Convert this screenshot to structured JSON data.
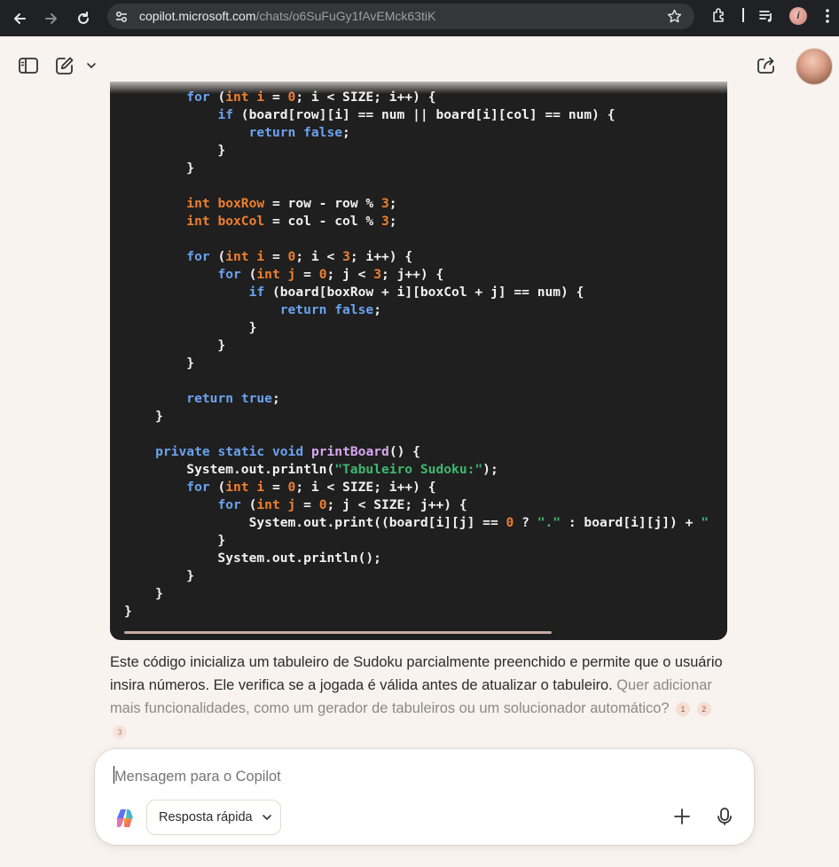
{
  "browser": {
    "url_domain": "copilot.microsoft.com",
    "url_path": "/chats/o6SuFuGy1fAvEMck63tiK",
    "profile_initial": "i"
  },
  "app": {
    "brand_accent": "#f5ded2"
  },
  "code": {
    "lines": [
      [
        {
          "t": "        "
        },
        {
          "t": "for",
          "c": "kw"
        },
        {
          "t": " ("
        },
        {
          "t": "int",
          "c": "ty"
        },
        {
          "t": " "
        },
        {
          "t": "i",
          "c": "ty"
        },
        {
          "t": " = "
        },
        {
          "t": "0",
          "c": "num"
        },
        {
          "t": "; i < SIZE; i++) {"
        }
      ],
      [
        {
          "t": "            "
        },
        {
          "t": "if",
          "c": "kw"
        },
        {
          "t": " (board[row][i] == num || board[i][col] == num) {"
        }
      ],
      [
        {
          "t": "                "
        },
        {
          "t": "return",
          "c": "kw"
        },
        {
          "t": " "
        },
        {
          "t": "false",
          "c": "kw"
        },
        {
          "t": ";"
        }
      ],
      [
        {
          "t": "            }"
        }
      ],
      [
        {
          "t": "        }"
        }
      ],
      [
        {
          "t": ""
        }
      ],
      [
        {
          "t": "        "
        },
        {
          "t": "int",
          "c": "ty"
        },
        {
          "t": " "
        },
        {
          "t": "boxRow",
          "c": "ty"
        },
        {
          "t": " = row - row % "
        },
        {
          "t": "3",
          "c": "num"
        },
        {
          "t": ";"
        }
      ],
      [
        {
          "t": "        "
        },
        {
          "t": "int",
          "c": "ty"
        },
        {
          "t": " "
        },
        {
          "t": "boxCol",
          "c": "ty"
        },
        {
          "t": " = col - col % "
        },
        {
          "t": "3",
          "c": "num"
        },
        {
          "t": ";"
        }
      ],
      [
        {
          "t": ""
        }
      ],
      [
        {
          "t": "        "
        },
        {
          "t": "for",
          "c": "kw"
        },
        {
          "t": " ("
        },
        {
          "t": "int",
          "c": "ty"
        },
        {
          "t": " "
        },
        {
          "t": "i",
          "c": "ty"
        },
        {
          "t": " = "
        },
        {
          "t": "0",
          "c": "num"
        },
        {
          "t": "; i < "
        },
        {
          "t": "3",
          "c": "num"
        },
        {
          "t": "; i++) {"
        }
      ],
      [
        {
          "t": "            "
        },
        {
          "t": "for",
          "c": "kw"
        },
        {
          "t": " ("
        },
        {
          "t": "int",
          "c": "ty"
        },
        {
          "t": " "
        },
        {
          "t": "j",
          "c": "ty"
        },
        {
          "t": " = "
        },
        {
          "t": "0",
          "c": "num"
        },
        {
          "t": "; j < "
        },
        {
          "t": "3",
          "c": "num"
        },
        {
          "t": "; j++) {"
        }
      ],
      [
        {
          "t": "                "
        },
        {
          "t": "if",
          "c": "kw"
        },
        {
          "t": " (board[boxRow + i][boxCol + j] == num) {"
        }
      ],
      [
        {
          "t": "                    "
        },
        {
          "t": "return",
          "c": "kw"
        },
        {
          "t": " "
        },
        {
          "t": "false",
          "c": "kw"
        },
        {
          "t": ";"
        }
      ],
      [
        {
          "t": "                }"
        }
      ],
      [
        {
          "t": "            }"
        }
      ],
      [
        {
          "t": "        }"
        }
      ],
      [
        {
          "t": ""
        }
      ],
      [
        {
          "t": "        "
        },
        {
          "t": "return",
          "c": "kw"
        },
        {
          "t": " "
        },
        {
          "t": "true",
          "c": "kw"
        },
        {
          "t": ";"
        }
      ],
      [
        {
          "t": "    }"
        }
      ],
      [
        {
          "t": ""
        }
      ],
      [
        {
          "t": "    "
        },
        {
          "t": "private",
          "c": "kw"
        },
        {
          "t": " "
        },
        {
          "t": "static",
          "c": "kw"
        },
        {
          "t": " "
        },
        {
          "t": "void",
          "c": "kw"
        },
        {
          "t": " "
        },
        {
          "t": "printBoard",
          "c": "fn"
        },
        {
          "t": "() {"
        }
      ],
      [
        {
          "t": "        System.out.println("
        },
        {
          "t": "\"Tabuleiro Sudoku:\"",
          "c": "str"
        },
        {
          "t": ");"
        }
      ],
      [
        {
          "t": "        "
        },
        {
          "t": "for",
          "c": "kw"
        },
        {
          "t": " ("
        },
        {
          "t": "int",
          "c": "ty"
        },
        {
          "t": " "
        },
        {
          "t": "i",
          "c": "ty"
        },
        {
          "t": " = "
        },
        {
          "t": "0",
          "c": "num"
        },
        {
          "t": "; i < SIZE; i++) {"
        }
      ],
      [
        {
          "t": "            "
        },
        {
          "t": "for",
          "c": "kw"
        },
        {
          "t": " ("
        },
        {
          "t": "int",
          "c": "ty"
        },
        {
          "t": " "
        },
        {
          "t": "j",
          "c": "ty"
        },
        {
          "t": " = "
        },
        {
          "t": "0",
          "c": "num"
        },
        {
          "t": "; j < SIZE; j++) {"
        }
      ],
      [
        {
          "t": "                System.out.print((board[i][j] == "
        },
        {
          "t": "0",
          "c": "num"
        },
        {
          "t": " ? "
        },
        {
          "t": "\".\"",
          "c": "str"
        },
        {
          "t": " : board[i][j]) + "
        },
        {
          "t": "\"",
          "c": "str"
        }
      ],
      [
        {
          "t": "            }"
        }
      ],
      [
        {
          "t": "            System.out.println();"
        }
      ],
      [
        {
          "t": "        }"
        }
      ],
      [
        {
          "t": "    }"
        }
      ],
      [
        {
          "t": "}"
        }
      ]
    ]
  },
  "response": {
    "text_main": "Este código inicializa um tabuleiro de Sudoku parcialmente preenchido e permite que o usuário insira números. Ele verifica se a jogada é válida antes de atualizar o tabuleiro.",
    "text_followup": "Quer adicionar mais funcionalidades, como um gerador de tabuleiros ou um solucionador automático?",
    "citations": [
      "1",
      "2",
      "3"
    ]
  },
  "composer": {
    "placeholder": "Mensagem para o Copilot",
    "mode_label": "Resposta rápida"
  }
}
